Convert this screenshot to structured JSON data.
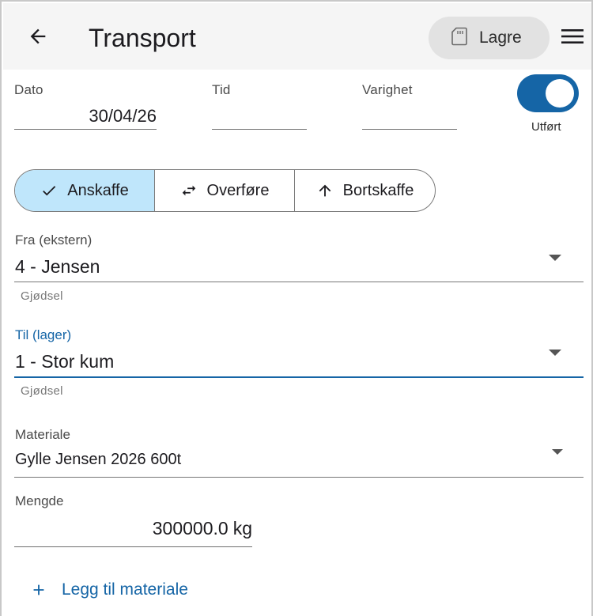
{
  "header": {
    "title": "Transport",
    "save_label": "Lagre",
    "back_icon": "arrow-left-icon",
    "save_icon": "sd-card-icon",
    "menu_icon": "hamburger-menu-icon"
  },
  "date_row": {
    "dato_label": "Dato",
    "dato_value": "30/04/26",
    "tid_label": "Tid",
    "tid_value": "",
    "varighet_label": "Varighet",
    "varighet_value": "",
    "utfort_label": "Utført",
    "utfort_on": true
  },
  "segments": [
    {
      "label": "Anskaffe",
      "icon": "check-icon",
      "active": true
    },
    {
      "label": "Overføre",
      "icon": "swap-horizontal-icon",
      "active": false
    },
    {
      "label": "Bortskaffe",
      "icon": "arrow-up-icon",
      "active": false
    }
  ],
  "fra": {
    "label": "Fra (ekstern)",
    "value": "4 - Jensen",
    "helper": "Gjødsel"
  },
  "til": {
    "label": "Til (lager)",
    "value": "1 - Stor kum",
    "helper": "Gjødsel"
  },
  "materiale": {
    "label": "Materiale",
    "value": "Gylle Jensen 2026 600t"
  },
  "mengde": {
    "label": "Mengde",
    "value": "300000.0",
    "unit": "kg"
  },
  "add_material_label": "Legg til materiale",
  "colors": {
    "accent": "#1565a6",
    "segment_active": "#bfe6fb",
    "header_bg": "#f5f5f5",
    "save_bg": "#e2e2e2"
  }
}
